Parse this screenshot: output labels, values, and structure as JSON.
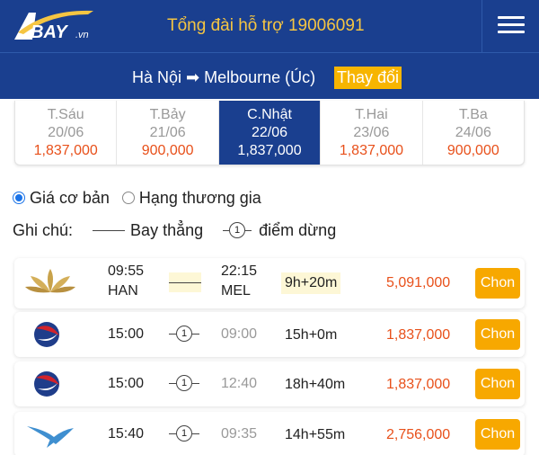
{
  "header": {
    "logo_text": "BAY.vn",
    "hotline": "Tổng đài hỗ trợ 19006091",
    "menu_icon": "hamburger-menu-icon"
  },
  "route": {
    "text": "Hà Nội ➡ Melbourne (Úc)",
    "change_label": "Thay đổi"
  },
  "dates": [
    {
      "dow": "T.Sáu",
      "dm": "20/06",
      "price": "1,837,000",
      "active": false
    },
    {
      "dow": "T.Bảy",
      "dm": "21/06",
      "price": "900,000",
      "active": false
    },
    {
      "dow": "C.Nhật",
      "dm": "22/06",
      "price": "1,837,000",
      "active": true
    },
    {
      "dow": "T.Hai",
      "dm": "23/06",
      "price": "1,837,000",
      "active": false
    },
    {
      "dow": "T.Ba",
      "dm": "24/06",
      "price": "900,000",
      "active": false
    }
  ],
  "fare": {
    "basic": "Giá cơ bản",
    "business": "Hạng thương gia",
    "selected": "basic"
  },
  "legend": {
    "label": "Ghi chú:",
    "direct": "Bay thẳng",
    "stops": "điểm dừng",
    "stop_count": "1"
  },
  "flights": [
    {
      "airline_icon": "vietnam-airlines-lotus-icon",
      "dep_time": "09:55",
      "dep_code": "HAN",
      "arr_time": "22:15",
      "arr_code": "MEL",
      "stops": "",
      "duration": "9h+20m",
      "price": "5,091,000",
      "button": "Chon"
    },
    {
      "airline_icon": "china-eastern-icon",
      "dep_time": "15:00",
      "dep_code": "",
      "arr_time": "09:00",
      "arr_code": "",
      "stops": "1",
      "duration": "15h+0m",
      "price": "1,837,000",
      "button": "Chon"
    },
    {
      "airline_icon": "china-eastern-icon",
      "dep_time": "15:00",
      "dep_code": "",
      "arr_time": "12:40",
      "arr_code": "",
      "stops": "1",
      "duration": "18h+40m",
      "price": "1,837,000",
      "button": "Chon"
    },
    {
      "airline_icon": "xiamen-airlines-icon",
      "dep_time": "15:40",
      "dep_code": "",
      "arr_time": "09:35",
      "arr_code": "",
      "stops": "1",
      "duration": "14h+55m",
      "price": "2,756,000",
      "button": "Chon"
    }
  ],
  "colors": {
    "header_bg": "#1a3f8f",
    "accent_yellow": "#f5c542",
    "button_orange": "#f7a800",
    "price_orange": "#e8501a"
  }
}
